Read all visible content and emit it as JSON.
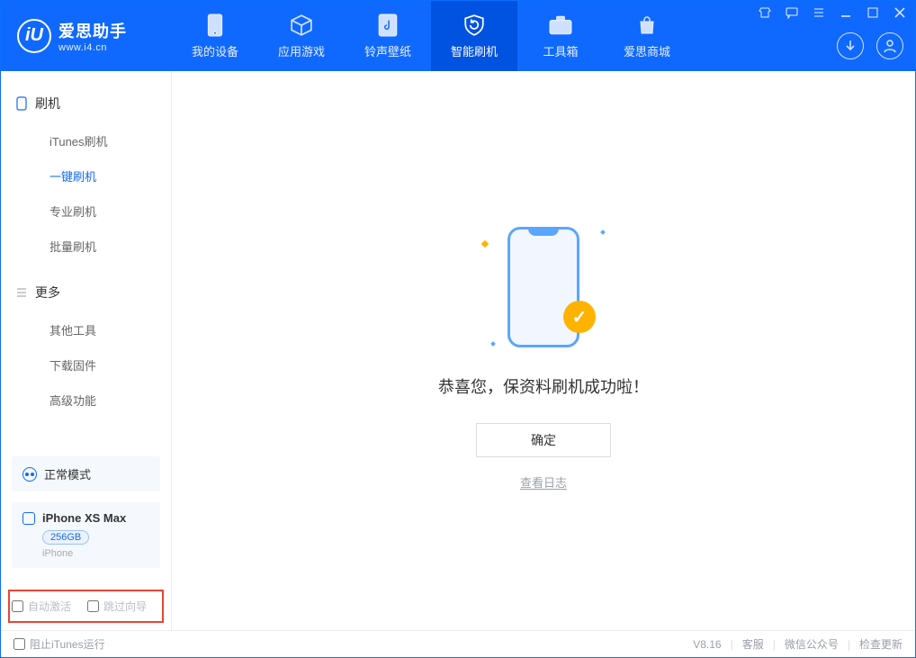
{
  "brand": {
    "name": "爱思助手",
    "url": "www.i4.cn"
  },
  "tabs": [
    {
      "key": "device",
      "label": "我的设备"
    },
    {
      "key": "apps",
      "label": "应用游戏"
    },
    {
      "key": "ring",
      "label": "铃声壁纸"
    },
    {
      "key": "flash",
      "label": "智能刷机",
      "active": true
    },
    {
      "key": "toolbox",
      "label": "工具箱"
    },
    {
      "key": "store",
      "label": "爱思商城"
    }
  ],
  "sidebar": {
    "groups": [
      {
        "title": "刷机",
        "items": [
          "iTunes刷机",
          "一键刷机",
          "专业刷机",
          "批量刷机"
        ],
        "activeIndex": 1
      },
      {
        "title": "更多",
        "items": [
          "其他工具",
          "下载固件",
          "高级功能"
        ]
      }
    ],
    "mode": "正常模式",
    "device": {
      "name": "iPhone XS Max",
      "storage": "256GB",
      "type": "iPhone"
    },
    "checkboxes": {
      "auto_activate": "自动激活",
      "skip_guide": "跳过向导"
    }
  },
  "main": {
    "success_message": "恭喜您，保资料刷机成功啦！",
    "confirm_button": "确定",
    "view_log": "查看日志"
  },
  "statusbar": {
    "block_itunes": "阻止iTunes运行",
    "version": "V8.16",
    "links": [
      "客服",
      "微信公众号",
      "检查更新"
    ]
  }
}
